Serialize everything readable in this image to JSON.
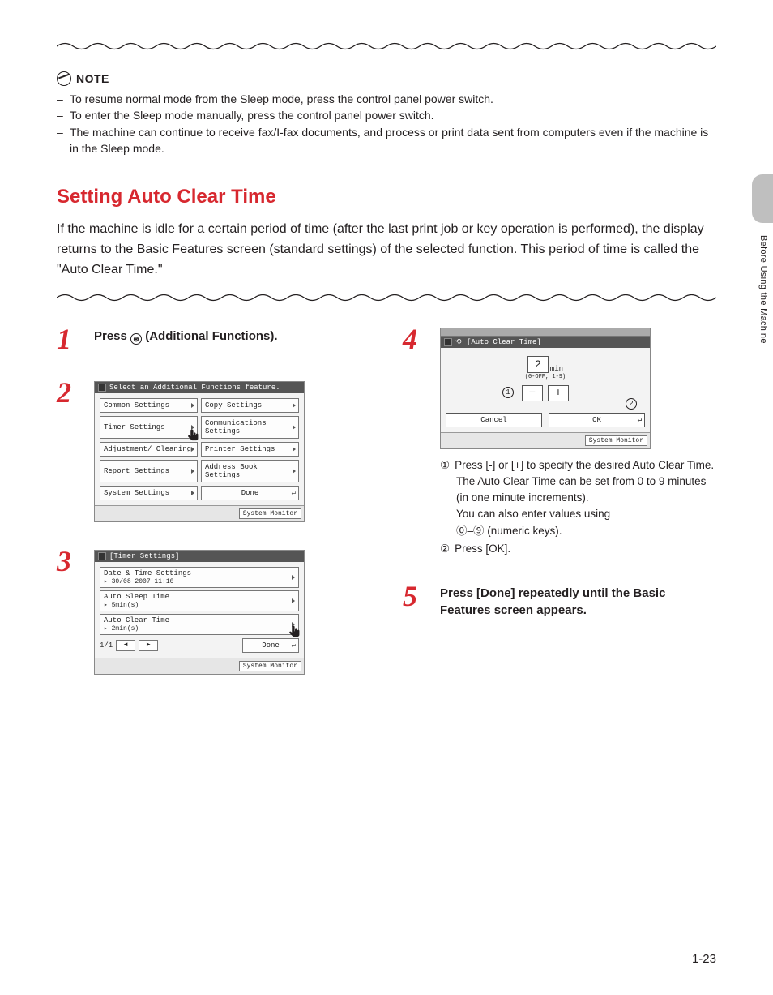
{
  "note": {
    "label": "NOTE",
    "items": [
      "To resume normal mode from the Sleep mode, press the control panel power switch.",
      "To enter the Sleep mode manually, press the control panel power switch.",
      "The machine can continue to receive fax/I-fax documents, and process or print data sent from computers even if the machine is in the Sleep mode."
    ]
  },
  "section": {
    "title": "Setting Auto Clear Time",
    "intro": "If the machine is idle for a certain period of time (after the last print job or key operation is performed), the display returns to the Basic Features screen (standard settings) of the selected function. This period of time is called the \"Auto Clear Time.\""
  },
  "steps": {
    "s1": {
      "num": "1",
      "prefix": "Press ",
      "suffix": " (Additional Functions)."
    },
    "s2": {
      "num": "2",
      "panel_header": "Select an Additional Functions feature.",
      "buttons": {
        "b0": "Common Settings",
        "b1": "Copy Settings",
        "b2": "Timer Settings",
        "b3": "Communications Settings",
        "b4": "Adjustment/ Cleaning",
        "b5": "Printer Settings",
        "b6": "Report Settings",
        "b7": "Address Book Settings",
        "b8": "System Settings",
        "done": "Done"
      },
      "sysmon": "System Monitor"
    },
    "s3": {
      "num": "3",
      "panel_header": "[Timer Settings]",
      "rows": {
        "r0": {
          "t": "Date & Time Settings",
          "s": "▸ 30/08 2007 11:10"
        },
        "r1": {
          "t": "Auto Sleep Time",
          "s": "▸ 5min(s)"
        },
        "r2": {
          "t": "Auto Clear Time",
          "s": "▸ 2min(s)"
        }
      },
      "pager": "1/1",
      "done": "Done",
      "sysmon": "System Monitor"
    },
    "s4": {
      "num": "4",
      "panel_header": "[Auto Clear Time]",
      "value": "2",
      "unit": "min",
      "range": "(0-OFF, 1-9)",
      "minus": "−",
      "plus": "+",
      "cancel": "Cancel",
      "ok": "OK",
      "sysmon": "System Monitor",
      "sub": {
        "a_pre": "Press [-] or [+] to specify the desired Auto Clear Time.",
        "a_line2": "The Auto Clear Time can be set from 0 to 9 minutes (in one minute increments).",
        "a_line3_pre": "You can also enter values using",
        "a_line3_suf": " (numeric keys).",
        "b": "Press [OK]."
      }
    },
    "s5": {
      "num": "5",
      "text": "Press [Done] repeatedly until the Basic Features screen appears."
    }
  },
  "side": {
    "label": "Before Using the Machine"
  },
  "pagenum": "1-23",
  "circles": {
    "one": "①",
    "two": "②",
    "zero_nine": "⓪–⑨"
  }
}
